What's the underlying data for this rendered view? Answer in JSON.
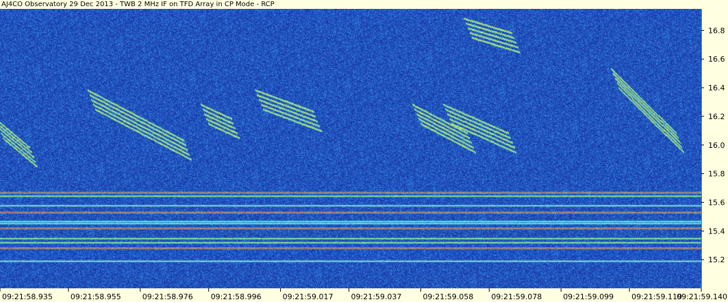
{
  "title": "AJ4CO Observatory 29 Dec 2013 - TWB 2 MHz IF on TFD Array in CP Mode - RCP",
  "chart_data": {
    "type": "heatmap",
    "title": "AJ4CO Observatory 29 Dec 2013 - TWB 2 MHz IF on TFD Array in CP Mode - RCP",
    "xlabel": "",
    "ylabel": "",
    "x_tick_labels": [
      "09:21:58.935",
      "09:21:58.955",
      "09:21:58.976",
      "09:21:58.996",
      "09:21:59.017",
      "09:21:59.037",
      "09:21:59.058",
      "09:21:59.078",
      "09:21:59.099",
      "09:21:59.119",
      "09:21:59.140"
    ],
    "y_tick_labels": [
      "16.8",
      "16.6",
      "16.4",
      "16.2",
      "16.0",
      "15.8",
      "15.6",
      "15.4",
      "15.2"
    ],
    "y_ticks": [
      16.8,
      16.6,
      16.4,
      16.2,
      16.0,
      15.8,
      15.6,
      15.4,
      15.2
    ],
    "ylim": [
      15.0,
      16.95
    ],
    "colormap": [
      "#0a1a6e",
      "#1a3fae",
      "#2f6fd8",
      "#36b3e8",
      "#8fe27a",
      "#f2f04a",
      "#f08a2a",
      "#e83a2a"
    ],
    "interference_lines_y": [
      15.67,
      15.645,
      15.58,
      15.53,
      15.47,
      15.455,
      15.42,
      15.35,
      15.32,
      15.28,
      15.19
    ],
    "features": [
      {
        "kind": "s-burst-cluster",
        "t_start": "09:21:58.935",
        "t_end": "09:21:58.945",
        "f_start": 16.1,
        "f_end": 15.9
      },
      {
        "kind": "s-burst-cluster",
        "t_start": "09:21:58.962",
        "t_end": "09:21:58.990",
        "f_start": 16.3,
        "f_end": 15.95
      },
      {
        "kind": "s-burst-cluster",
        "t_start": "09:21:58.995",
        "t_end": "09:21:59.004",
        "f_start": 16.2,
        "f_end": 16.1
      },
      {
        "kind": "s-burst-cluster",
        "t_start": "09:21:59.011",
        "t_end": "09:21:59.028",
        "f_start": 16.3,
        "f_end": 16.15
      },
      {
        "kind": "s-burst-cluster",
        "t_start": "09:21:59.057",
        "t_end": "09:21:59.073",
        "f_start": 16.2,
        "f_end": 16.0
      },
      {
        "kind": "s-burst-cluster",
        "t_start": "09:21:59.066",
        "t_end": "09:21:59.085",
        "f_start": 16.2,
        "f_end": 16.0
      },
      {
        "kind": "s-burst-cluster",
        "t_start": "09:21:59.115",
        "t_end": "09:21:59.134",
        "f_start": 16.45,
        "f_end": 16.0
      },
      {
        "kind": "s-burst-cluster",
        "t_start": "09:21:59.072",
        "t_end": "09:21:59.086",
        "f_start": 16.8,
        "f_end": 16.7
      }
    ]
  }
}
